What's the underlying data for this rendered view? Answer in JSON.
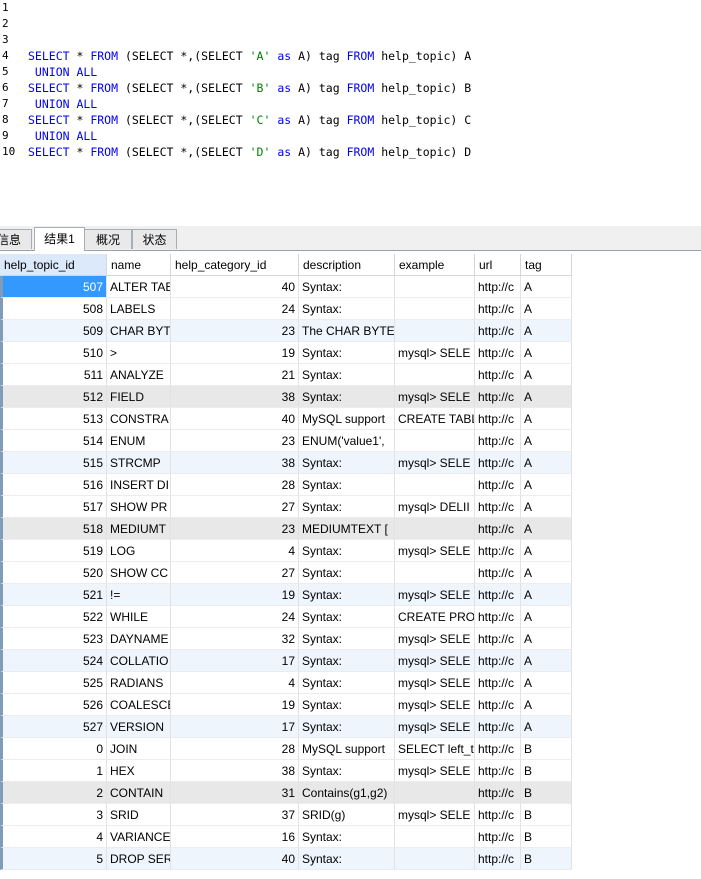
{
  "editor": {
    "line_numbers": [
      "1",
      "2",
      "3",
      "4",
      "5",
      "6",
      "7",
      "8",
      "9",
      "10"
    ],
    "lines": [
      [],
      [],
      [],
      [
        {
          "t": "SELECT",
          "c": "kw"
        },
        {
          "t": " * "
        },
        {
          "t": "FROM",
          "c": "kw"
        },
        {
          "t": " (SELECT *,(SELECT "
        },
        {
          "t": "'A'",
          "c": "str"
        },
        {
          "t": " "
        },
        {
          "t": "as",
          "c": "kw"
        },
        {
          "t": " A) tag "
        },
        {
          "t": "FROM",
          "c": "kw"
        },
        {
          "t": " help_topic) A"
        }
      ],
      [
        {
          "t": " UNION ALL",
          "c": "kw"
        }
      ],
      [
        {
          "t": "SELECT",
          "c": "kw"
        },
        {
          "t": " * "
        },
        {
          "t": "FROM",
          "c": "kw"
        },
        {
          "t": " (SELECT *,(SELECT "
        },
        {
          "t": "'B'",
          "c": "str"
        },
        {
          "t": " "
        },
        {
          "t": "as",
          "c": "kw"
        },
        {
          "t": " A) tag "
        },
        {
          "t": "FROM",
          "c": "kw"
        },
        {
          "t": " help_topic) B"
        }
      ],
      [
        {
          "t": " UNION ALL",
          "c": "kw"
        }
      ],
      [
        {
          "t": "SELECT",
          "c": "kw"
        },
        {
          "t": " * "
        },
        {
          "t": "FROM",
          "c": "kw"
        },
        {
          "t": " (SELECT *,(SELECT "
        },
        {
          "t": "'C'",
          "c": "str"
        },
        {
          "t": " "
        },
        {
          "t": "as",
          "c": "kw"
        },
        {
          "t": " A) tag "
        },
        {
          "t": "FROM",
          "c": "kw"
        },
        {
          "t": " help_topic) C"
        }
      ],
      [
        {
          "t": " UNION ALL",
          "c": "kw"
        }
      ],
      [
        {
          "t": "SELECT",
          "c": "kw"
        },
        {
          "t": " * "
        },
        {
          "t": "FROM",
          "c": "kw"
        },
        {
          "t": " (SELECT *,(SELECT "
        },
        {
          "t": "'D'",
          "c": "str"
        },
        {
          "t": " "
        },
        {
          "t": "as",
          "c": "kw"
        },
        {
          "t": " A) tag "
        },
        {
          "t": "FROM",
          "c": "kw"
        },
        {
          "t": " help_topic) D"
        }
      ]
    ],
    "colors": {
      "keyword": "#0000ff",
      "string": "#008000"
    }
  },
  "tabs": [
    {
      "label": "信息",
      "active": false
    },
    {
      "label": "结果1",
      "active": true
    },
    {
      "label": "概况",
      "active": false
    },
    {
      "label": "状态",
      "active": false
    }
  ],
  "grid": {
    "columns": [
      "help_topic_id",
      "name",
      "help_category_id",
      "description",
      "example",
      "url",
      "tag"
    ],
    "selected_column": 0,
    "row_colors": {
      "alt": "#eef5fd",
      "gray": "#e8e8e8",
      "cursor": "#3399ff"
    },
    "rows": [
      {
        "cells": [
          "507",
          "ALTER TAE",
          "40",
          "Syntax:",
          "",
          "http://c",
          "A"
        ],
        "style": "cursor"
      },
      {
        "cells": [
          "508",
          "LABELS",
          "24",
          "Syntax:",
          "",
          "http://c",
          "A"
        ],
        "style": "white"
      },
      {
        "cells": [
          "509",
          "CHAR BYT",
          "23",
          "The CHAR BYTE",
          "",
          "http://c",
          "A"
        ],
        "style": "alt"
      },
      {
        "cells": [
          "510",
          ">",
          "19",
          "Syntax:",
          "mysql> SELE",
          "http://c",
          "A"
        ],
        "style": "white"
      },
      {
        "cells": [
          "511",
          "ANALYZE ",
          "21",
          "Syntax:",
          "",
          "http://c",
          "A"
        ],
        "style": "white"
      },
      {
        "cells": [
          "512",
          "FIELD",
          "38",
          "Syntax:",
          "mysql> SELE",
          "http://c",
          "A"
        ],
        "style": "gray"
      },
      {
        "cells": [
          "513",
          "CONSTRA",
          "40",
          "MySQL support",
          "CREATE TABL",
          "http://c",
          "A"
        ],
        "style": "white"
      },
      {
        "cells": [
          "514",
          "ENUM",
          "23",
          "ENUM('value1',",
          "",
          "http://c",
          "A"
        ],
        "style": "white"
      },
      {
        "cells": [
          "515",
          "STRCMP",
          "38",
          "Syntax:",
          "mysql> SELE",
          "http://c",
          "A"
        ],
        "style": "alt"
      },
      {
        "cells": [
          "516",
          "INSERT DI",
          "28",
          "Syntax:",
          "",
          "http://c",
          "A"
        ],
        "style": "white"
      },
      {
        "cells": [
          "517",
          "SHOW PR",
          "27",
          "Syntax:",
          "mysql> DELII",
          "http://c",
          "A"
        ],
        "style": "white"
      },
      {
        "cells": [
          "518",
          "MEDIUMT",
          "23",
          "MEDIUMTEXT [",
          "",
          "http://c",
          "A"
        ],
        "style": "gray"
      },
      {
        "cells": [
          "519",
          "LOG",
          "4",
          "Syntax:",
          "mysql> SELE",
          "http://c",
          "A"
        ],
        "style": "white"
      },
      {
        "cells": [
          "520",
          "SHOW CC",
          "27",
          "Syntax:",
          "",
          "http://c",
          "A"
        ],
        "style": "white"
      },
      {
        "cells": [
          "521",
          "!=",
          "19",
          "Syntax:",
          "mysql> SELE",
          "http://c",
          "A"
        ],
        "style": "alt"
      },
      {
        "cells": [
          "522",
          "WHILE",
          "24",
          "Syntax:",
          "CREATE PRO",
          "http://c",
          "A"
        ],
        "style": "white"
      },
      {
        "cells": [
          "523",
          "DAYNAME",
          "32",
          "Syntax:",
          "mysql> SELE",
          "http://c",
          "A"
        ],
        "style": "white"
      },
      {
        "cells": [
          "524",
          "COLLATIO",
          "17",
          "Syntax:",
          "mysql> SELE",
          "http://c",
          "A"
        ],
        "style": "alt"
      },
      {
        "cells": [
          "525",
          "RADIANS",
          "4",
          "Syntax:",
          "mysql> SELE",
          "http://c",
          "A"
        ],
        "style": "white"
      },
      {
        "cells": [
          "526",
          "COALESCE",
          "19",
          "Syntax:",
          "mysql> SELE",
          "http://c",
          "A"
        ],
        "style": "white"
      },
      {
        "cells": [
          "527",
          "VERSION",
          "17",
          "Syntax:",
          "mysql> SELE",
          "http://c",
          "A"
        ],
        "style": "alt"
      },
      {
        "cells": [
          "0",
          "JOIN",
          "28",
          "MySQL support",
          "SELECT left_tl",
          "http://c",
          "B"
        ],
        "style": "white"
      },
      {
        "cells": [
          "1",
          "HEX",
          "38",
          "Syntax:",
          "mysql> SELE",
          "http://c",
          "B"
        ],
        "style": "white"
      },
      {
        "cells": [
          "2",
          "CONTAIN",
          "31",
          "Contains(g1,g2)",
          "",
          "http://c",
          "B"
        ],
        "style": "gray"
      },
      {
        "cells": [
          "3",
          "SRID",
          "37",
          "SRID(g)",
          "mysql> SELE",
          "http://c",
          "B"
        ],
        "style": "white"
      },
      {
        "cells": [
          "4",
          "VARIANCE",
          "16",
          "Syntax:",
          "",
          "http://c",
          "B"
        ],
        "style": "white"
      },
      {
        "cells": [
          "5",
          "DROP SER",
          "40",
          "Syntax:",
          "",
          "http://c",
          "B"
        ],
        "style": "alt"
      }
    ]
  }
}
